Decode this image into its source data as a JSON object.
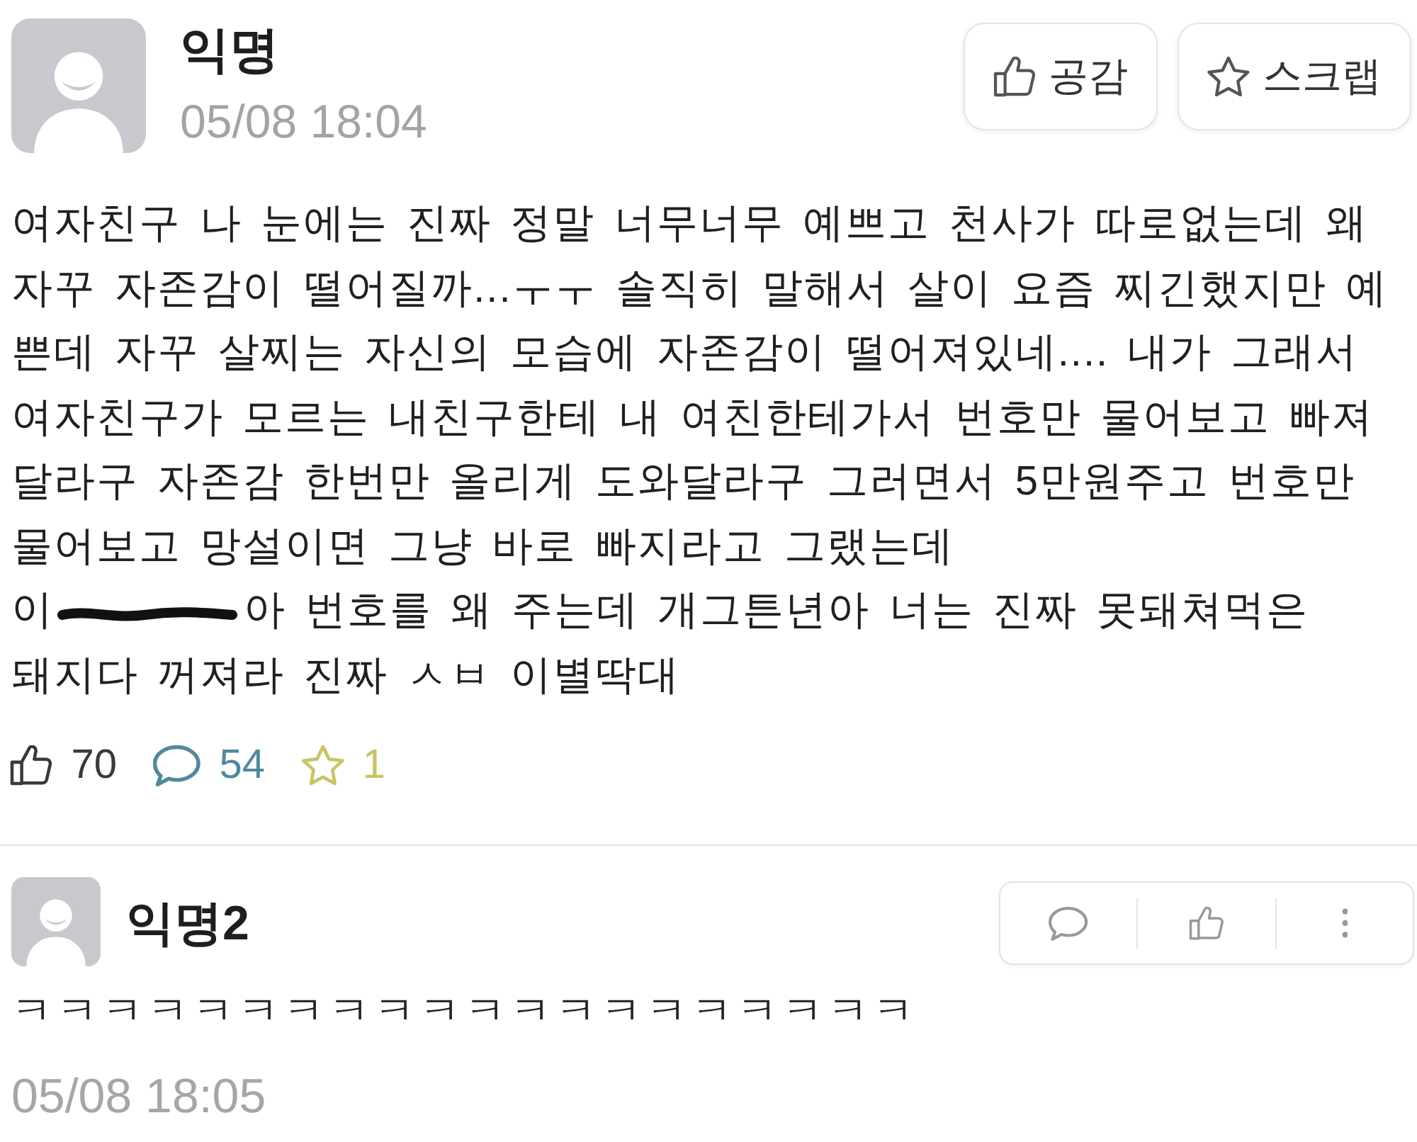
{
  "post": {
    "author": "익명",
    "time": "05/08 18:04",
    "actions": [
      {
        "kind": "like",
        "label": "공감"
      },
      {
        "kind": "scrap",
        "label": "스크랩"
      }
    ],
    "body": [
      {
        "kind": "text",
        "text": "여자친구 나 눈에는 진짜 정말 너무너무 예쁘고 천사가 따로없는데 왜 자꾸 자존감이 떨어질까...ㅜㅜ 솔직히 말해서 살이 요즘 찌긴했지만 예쁜데 자꾸 살찌는 자신의 모습에 자존감이 떨어져있네.... 내가 그래서 여자친구가 모르는 내친구한테 내 여친한테가서 번호만 물어보고 빠져달라구 자존감 한번만 올리게 도와달라구 그러면서 5만원주고 번호만 물어보고 망설이면 그냥 바로 빠지라고 그랬는데"
      },
      {
        "kind": "line",
        "segments": [
          {
            "kind": "text",
            "text": "이"
          },
          {
            "kind": "redaction"
          },
          {
            "kind": "text",
            "text": "아 번호를 왜 주는데 개그튼년아 너는 진짜 못돼쳐먹은"
          }
        ]
      },
      {
        "kind": "text",
        "text": "돼지다 꺼져라 진짜 ㅅㅂ 이별딱대"
      }
    ],
    "stats": [
      {
        "kind": "likes",
        "count": "70",
        "color": "#3a3a3a"
      },
      {
        "kind": "comments",
        "count": "54",
        "color": "#4f8a9c"
      },
      {
        "kind": "scraps",
        "count": "1",
        "color": "#c8c466"
      }
    ]
  },
  "comments": [
    {
      "author": "익명2",
      "actions": [
        {
          "kind": "reply"
        },
        {
          "kind": "like"
        },
        {
          "kind": "more"
        }
      ],
      "text": "ㅋㅋㅋㅋㅋㅋㅋㅋㅋㅋㅋㅋㅋㅋㅋㅋㅋㅋㅋㅋ",
      "time": "05/08 18:05"
    }
  ]
}
